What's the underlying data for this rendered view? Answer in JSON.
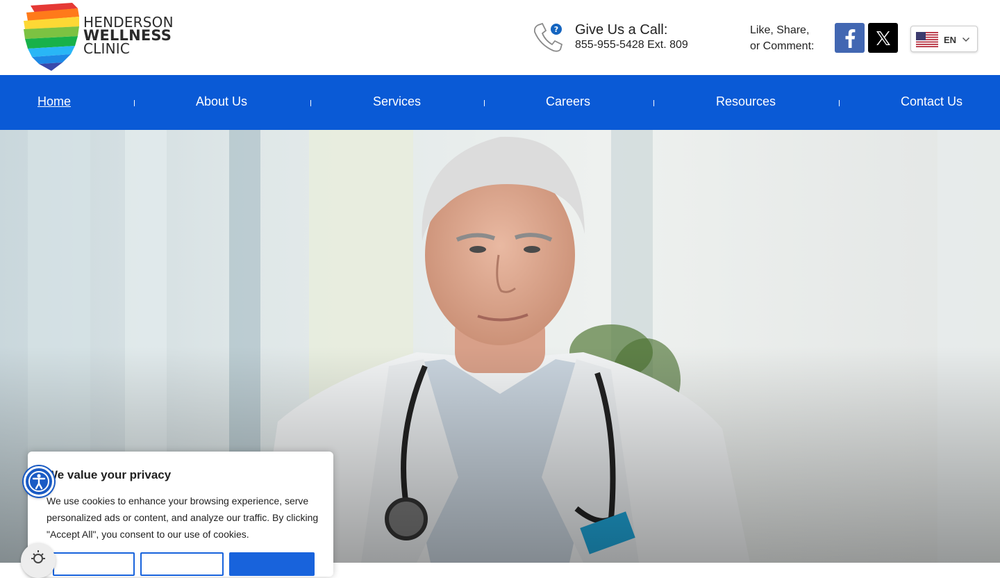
{
  "logo": {
    "line1": "HENDERSON",
    "line2": "WELLNESS",
    "line3": "CLINIC"
  },
  "contact": {
    "title": "Give Us a Call:",
    "phone": "855-955-5428 Ext. 809"
  },
  "social": {
    "line1": "Like, Share,",
    "line2": "or Comment:",
    "icons": [
      "facebook-icon",
      "x-icon"
    ]
  },
  "language": {
    "code": "EN",
    "flag": "us-flag-icon"
  },
  "nav": {
    "items": [
      {
        "label": "Home",
        "active": true
      },
      {
        "label": "About Us"
      },
      {
        "label": "Services"
      },
      {
        "label": "Careers"
      },
      {
        "label": "Resources"
      },
      {
        "label": "Contact Us"
      }
    ]
  },
  "cookie": {
    "title": "We value your privacy",
    "body": "We use cookies to enhance your browsing experience, serve personalized ads or content, and analyze our traffic. By clicking \"Accept All\", you consent to our use of cookies.",
    "buttons": [
      "",
      "",
      ""
    ]
  },
  "colors": {
    "nav_bg": "#0a5ad6",
    "accent": "#1863dc",
    "facebook": "#4267b2",
    "x": "#000000"
  }
}
